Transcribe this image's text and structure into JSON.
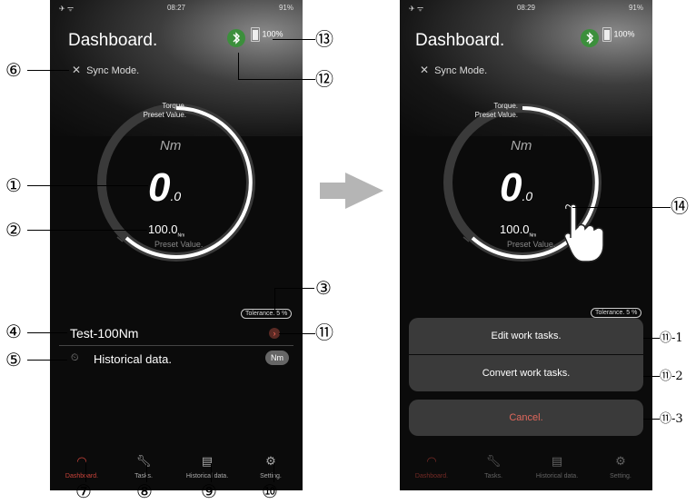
{
  "screen_left": {
    "status_time": "08:27",
    "status_battery": "91%",
    "title": "Dashboard.",
    "battery_pct": "100%",
    "sync_label": "Sync Mode.",
    "gauge_top_label_1": "Torque.",
    "gauge_top_label_2": "Preset Value.",
    "unit": "Nm",
    "big_value": "0",
    "big_value_decimal": ".0",
    "preset_value": "100.0",
    "preset_unit": "Nm",
    "preset_label": "Preset Value.",
    "tolerance": "Tolerance. 5 %",
    "task_name": "Test-100Nm",
    "history_label": "Historical data.",
    "history_unit": "Nm"
  },
  "screen_right": {
    "status_time": "08:29",
    "status_battery": "91%",
    "title": "Dashboard.",
    "battery_pct": "100%",
    "sync_label": "Sync Mode.",
    "gauge_top_label_1": "Torque.",
    "gauge_top_label_2": "Preset Value.",
    "unit": "Nm",
    "big_value": "0",
    "big_value_decimal": ".0",
    "preset_value": "100.0",
    "preset_unit": "Nm",
    "preset_label": "Preset Value.",
    "tolerance": "Tolerance. 5 %",
    "sheet_edit": "Edit work tasks.",
    "sheet_convert": "Convert work tasks.",
    "sheet_cancel": "Cancel."
  },
  "tabs": [
    "Dashboard.",
    "Tasks.",
    "Historical data.",
    "Setting."
  ],
  "callouts": {
    "c1": "①",
    "c2": "②",
    "c3": "③",
    "c4": "④",
    "c5": "⑤",
    "c6": "⑥",
    "c7": "⑦",
    "c8": "⑧",
    "c9": "⑨",
    "c10": "⑩",
    "c11": "⑪",
    "c12": "⑫",
    "c13": "⑬",
    "c14": "⑭",
    "c11_1": "⑪-1",
    "c11_2": "⑪-2",
    "c11_3": "⑪-3"
  },
  "colors": {
    "accent": "#c9433a",
    "background": "#0b0b0b",
    "sheet": "#3a3a3a"
  }
}
